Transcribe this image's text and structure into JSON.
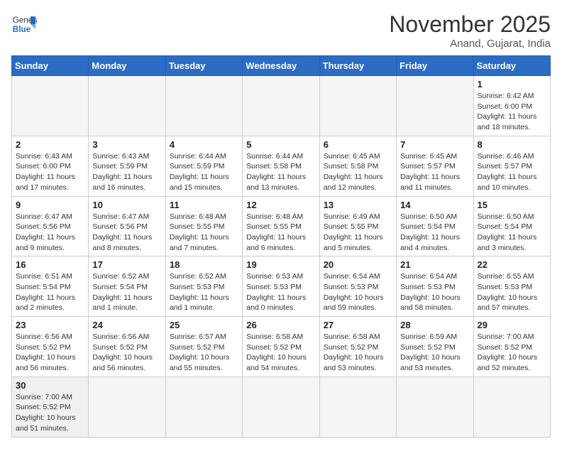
{
  "logo": {
    "text_general": "General",
    "text_blue": "Blue"
  },
  "header": {
    "month": "November 2025",
    "location": "Anand, Gujarat, India"
  },
  "weekdays": [
    "Sunday",
    "Monday",
    "Tuesday",
    "Wednesday",
    "Thursday",
    "Friday",
    "Saturday"
  ],
  "days": [
    {
      "date": "",
      "info": ""
    },
    {
      "date": "",
      "info": ""
    },
    {
      "date": "",
      "info": ""
    },
    {
      "date": "",
      "info": ""
    },
    {
      "date": "",
      "info": ""
    },
    {
      "date": "",
      "info": ""
    },
    {
      "date": "1",
      "info": "Sunrise: 6:42 AM\nSunset: 6:00 PM\nDaylight: 11 hours and 18 minutes."
    },
    {
      "date": "2",
      "info": "Sunrise: 6:43 AM\nSunset: 6:00 PM\nDaylight: 11 hours and 17 minutes."
    },
    {
      "date": "3",
      "info": "Sunrise: 6:43 AM\nSunset: 5:59 PM\nDaylight: 11 hours and 16 minutes."
    },
    {
      "date": "4",
      "info": "Sunrise: 6:44 AM\nSunset: 5:59 PM\nDaylight: 11 hours and 15 minutes."
    },
    {
      "date": "5",
      "info": "Sunrise: 6:44 AM\nSunset: 5:58 PM\nDaylight: 11 hours and 13 minutes."
    },
    {
      "date": "6",
      "info": "Sunrise: 6:45 AM\nSunset: 5:58 PM\nDaylight: 11 hours and 12 minutes."
    },
    {
      "date": "7",
      "info": "Sunrise: 6:45 AM\nSunset: 5:57 PM\nDaylight: 11 hours and 11 minutes."
    },
    {
      "date": "8",
      "info": "Sunrise: 6:46 AM\nSunset: 5:57 PM\nDaylight: 11 hours and 10 minutes."
    },
    {
      "date": "9",
      "info": "Sunrise: 6:47 AM\nSunset: 5:56 PM\nDaylight: 11 hours and 9 minutes."
    },
    {
      "date": "10",
      "info": "Sunrise: 6:47 AM\nSunset: 5:56 PM\nDaylight: 11 hours and 8 minutes."
    },
    {
      "date": "11",
      "info": "Sunrise: 6:48 AM\nSunset: 5:55 PM\nDaylight: 11 hours and 7 minutes."
    },
    {
      "date": "12",
      "info": "Sunrise: 6:48 AM\nSunset: 5:55 PM\nDaylight: 11 hours and 6 minutes."
    },
    {
      "date": "13",
      "info": "Sunrise: 6:49 AM\nSunset: 5:55 PM\nDaylight: 11 hours and 5 minutes."
    },
    {
      "date": "14",
      "info": "Sunrise: 6:50 AM\nSunset: 5:54 PM\nDaylight: 11 hours and 4 minutes."
    },
    {
      "date": "15",
      "info": "Sunrise: 6:50 AM\nSunset: 5:54 PM\nDaylight: 11 hours and 3 minutes."
    },
    {
      "date": "16",
      "info": "Sunrise: 6:51 AM\nSunset: 5:54 PM\nDaylight: 11 hours and 2 minutes."
    },
    {
      "date": "17",
      "info": "Sunrise: 6:52 AM\nSunset: 5:54 PM\nDaylight: 11 hours and 1 minute."
    },
    {
      "date": "18",
      "info": "Sunrise: 6:52 AM\nSunset: 5:53 PM\nDaylight: 11 hours and 1 minute."
    },
    {
      "date": "19",
      "info": "Sunrise: 6:53 AM\nSunset: 5:53 PM\nDaylight: 11 hours and 0 minutes."
    },
    {
      "date": "20",
      "info": "Sunrise: 6:54 AM\nSunset: 5:53 PM\nDaylight: 10 hours and 59 minutes."
    },
    {
      "date": "21",
      "info": "Sunrise: 6:54 AM\nSunset: 5:53 PM\nDaylight: 10 hours and 58 minutes."
    },
    {
      "date": "22",
      "info": "Sunrise: 6:55 AM\nSunset: 5:53 PM\nDaylight: 10 hours and 57 minutes."
    },
    {
      "date": "23",
      "info": "Sunrise: 6:56 AM\nSunset: 5:52 PM\nDaylight: 10 hours and 56 minutes."
    },
    {
      "date": "24",
      "info": "Sunrise: 6:56 AM\nSunset: 5:52 PM\nDaylight: 10 hours and 56 minutes."
    },
    {
      "date": "25",
      "info": "Sunrise: 6:57 AM\nSunset: 5:52 PM\nDaylight: 10 hours and 55 minutes."
    },
    {
      "date": "26",
      "info": "Sunrise: 6:58 AM\nSunset: 5:52 PM\nDaylight: 10 hours and 54 minutes."
    },
    {
      "date": "27",
      "info": "Sunrise: 6:58 AM\nSunset: 5:52 PM\nDaylight: 10 hours and 53 minutes."
    },
    {
      "date": "28",
      "info": "Sunrise: 6:59 AM\nSunset: 5:52 PM\nDaylight: 10 hours and 53 minutes."
    },
    {
      "date": "29",
      "info": "Sunrise: 7:00 AM\nSunset: 5:52 PM\nDaylight: 10 hours and 52 minutes."
    },
    {
      "date": "30",
      "info": "Sunrise: 7:00 AM\nSunset: 5:52 PM\nDaylight: 10 hours and 51 minutes."
    }
  ]
}
